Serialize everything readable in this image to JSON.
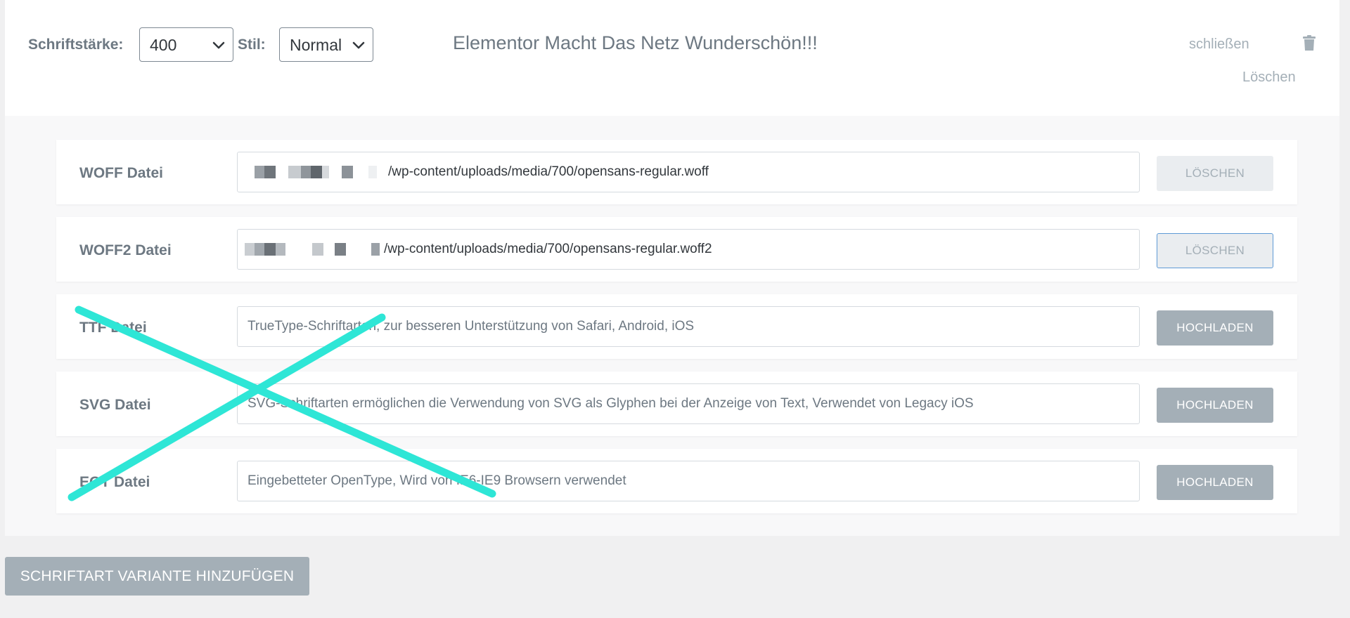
{
  "header": {
    "weight_label": "Schriftstärke:",
    "weight_value": "400",
    "style_label": "Stil:",
    "style_value": "Normal",
    "preview_text": "Elementor Macht Das Netz Wunderschön!!!",
    "close_label": "schließen",
    "delete_label": "Löschen"
  },
  "rows": [
    {
      "label": "WOFF Datei",
      "value": "/wp-content/uploads/media/700/opensans-regular.woff",
      "button": "LÖSCHEN"
    },
    {
      "label": "WOFF2 Datei",
      "value": "/wp-content/uploads/media/700/opensans-regular.woff2",
      "button": "LÖSCHEN"
    },
    {
      "label": "TTF Datei",
      "placeholder": "TrueType-Schriftarten, zur besseren Unterstützung von Safari, Android, iOS",
      "button": "HOCHLADEN"
    },
    {
      "label": "SVG Datei",
      "placeholder": "SVG-Schriftarten ermöglichen die Verwendung von SVG als Glyphen bei der Anzeige von Text, Verwendet von Legacy iOS",
      "button": "HOCHLADEN"
    },
    {
      "label": "EOT Datei",
      "placeholder": "Eingebetteter OpenType, Wird von IE6-IE9 Browsern verwendet",
      "button": "HOCHLADEN"
    }
  ],
  "add_variant_label": "SCHRIFTART VARIANTE HINZUFÜGEN",
  "colors": {
    "annotation_cross": "#2ee6d6",
    "button_gray": "#a4afb7",
    "focus_blue": "#5e9ad6"
  }
}
